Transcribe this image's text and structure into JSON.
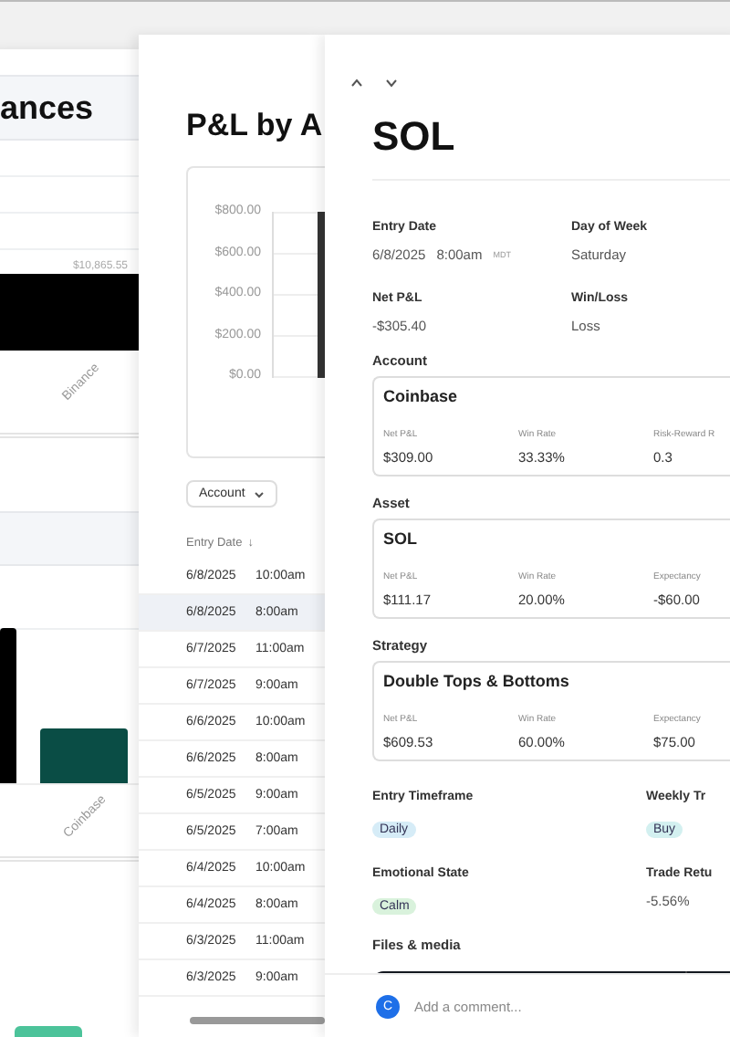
{
  "balances_panel": {
    "title": "ances",
    "top_chart": {
      "data_label": "$10,865.55",
      "category": "Binance"
    },
    "bottom_chart": {
      "category": "Coinbase"
    }
  },
  "pnl_panel": {
    "title": "P&L by A",
    "y_axis_labels": [
      "$800.00",
      "$600.00",
      "$400.00",
      "$200.00",
      "$0.00"
    ],
    "filter": "Account",
    "sort_column": "Entry Date",
    "sort_icon": "↓",
    "rows": [
      {
        "date": "6/8/2025",
        "time": "10:00am",
        "selected": false
      },
      {
        "date": "6/8/2025",
        "time": "8:00am",
        "selected": true
      },
      {
        "date": "6/7/2025",
        "time": "11:00am",
        "selected": false
      },
      {
        "date": "6/7/2025",
        "time": "9:00am",
        "selected": false
      },
      {
        "date": "6/6/2025",
        "time": "10:00am",
        "selected": false
      },
      {
        "date": "6/6/2025",
        "time": "8:00am",
        "selected": false
      },
      {
        "date": "6/5/2025",
        "time": "9:00am",
        "selected": false
      },
      {
        "date": "6/5/2025",
        "time": "7:00am",
        "selected": false
      },
      {
        "date": "6/4/2025",
        "time": "10:00am",
        "selected": false
      },
      {
        "date": "6/4/2025",
        "time": "8:00am",
        "selected": false
      },
      {
        "date": "6/3/2025",
        "time": "11:00am",
        "selected": false
      },
      {
        "date": "6/3/2025",
        "time": "9:00am",
        "selected": false
      }
    ]
  },
  "detail": {
    "title": "SOL",
    "fields": [
      {
        "label": "Entry Date",
        "value": "6/8/2025",
        "time": "8:00am",
        "zone": "MDT"
      },
      {
        "label": "Day of Week",
        "value": "Saturday"
      },
      {
        "label": "Net P&L",
        "value": "-$305.40"
      },
      {
        "label": "Win/Loss",
        "value": "Loss"
      }
    ],
    "cards": [
      {
        "label": "Account",
        "name": "Coinbase",
        "stats": [
          {
            "label": "Net P&L",
            "value": "$309.00"
          },
          {
            "label": "Win Rate",
            "value": "33.33%"
          },
          {
            "label": "Risk-Reward R",
            "value": "0.3"
          }
        ]
      },
      {
        "label": "Asset",
        "name": "SOL",
        "stats": [
          {
            "label": "Net P&L",
            "value": "$111.17"
          },
          {
            "label": "Win Rate",
            "value": "20.00%"
          },
          {
            "label": "Expectancy",
            "value": "-$60.00"
          }
        ]
      },
      {
        "label": "Strategy",
        "name": "Double Tops & Bottoms",
        "stats": [
          {
            "label": "Net P&L",
            "value": "$609.53"
          },
          {
            "label": "Win Rate",
            "value": "60.00%"
          },
          {
            "label": "Expectancy",
            "value": "$75.00"
          }
        ]
      }
    ],
    "attributes": [
      {
        "label": "Entry Timeframe",
        "kind": "tag",
        "value": "Daily",
        "color": "#d6ecf7"
      },
      {
        "label": "Weekly Tr",
        "kind": "tag",
        "value": "Buy",
        "color": "#d3f0f0"
      },
      {
        "label": "Emotional State",
        "kind": "tag",
        "value": "Calm",
        "color": "#d9f2dc"
      },
      {
        "label": "Trade Retu",
        "kind": "text",
        "value": "-5.56%"
      }
    ],
    "media_label": "Files & media",
    "comment": {
      "avatar": "C",
      "placeholder": "Add a comment..."
    }
  }
}
